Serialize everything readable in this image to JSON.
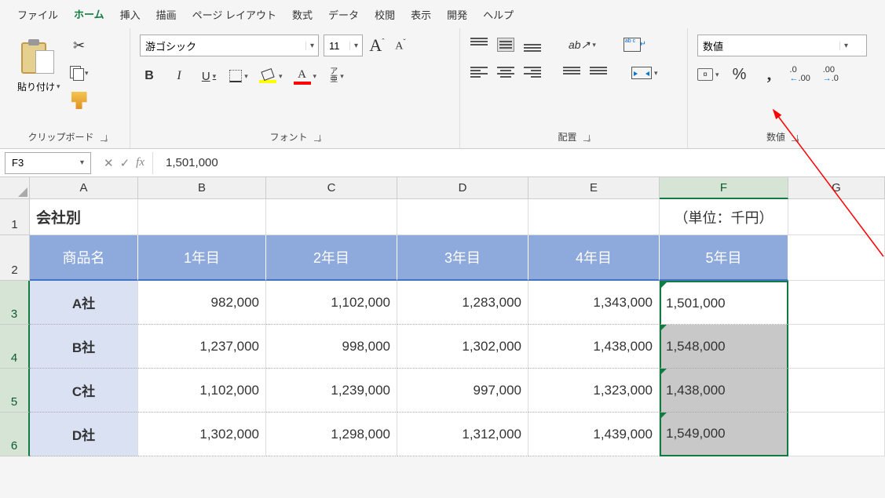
{
  "menu": [
    "ファイル",
    "ホーム",
    "挿入",
    "描画",
    "ページ レイアウト",
    "数式",
    "データ",
    "校閲",
    "表示",
    "開発",
    "ヘルプ"
  ],
  "active_menu": 1,
  "ribbon": {
    "clipboard": {
      "paste": "貼り付け",
      "label": "クリップボード"
    },
    "font": {
      "name": "游ゴシック",
      "size": "11",
      "label": "フォント",
      "ruby": "ア\n亜"
    },
    "alignment": {
      "label": "配置"
    },
    "number": {
      "format": "数値",
      "label": "数値"
    }
  },
  "namebox": "F3",
  "formula": "1,501,000",
  "columns": [
    "A",
    "B",
    "C",
    "D",
    "E",
    "F",
    "G"
  ],
  "row_numbers": [
    "1",
    "2",
    "3",
    "4",
    "5",
    "6"
  ],
  "chart_data": {
    "type": "table",
    "title": "会社別",
    "unit": "（単位：千円）",
    "headers": [
      "商品名",
      "1年目",
      "2年目",
      "3年目",
      "4年目",
      "5年目"
    ],
    "rows": [
      {
        "name": "A社",
        "v": [
          "982,000",
          "1,102,000",
          "1,283,000",
          "1,343,000",
          "1,501,000"
        ]
      },
      {
        "name": "B社",
        "v": [
          "1,237,000",
          "998,000",
          "1,302,000",
          "1,438,000",
          "1,548,000"
        ]
      },
      {
        "name": "C社",
        "v": [
          "1,102,000",
          "1,239,000",
          "997,000",
          "1,323,000",
          "1,438,000"
        ]
      },
      {
        "name": "D社",
        "v": [
          "1,302,000",
          "1,298,000",
          "1,312,000",
          "1,439,000",
          "1,549,000"
        ]
      }
    ]
  }
}
